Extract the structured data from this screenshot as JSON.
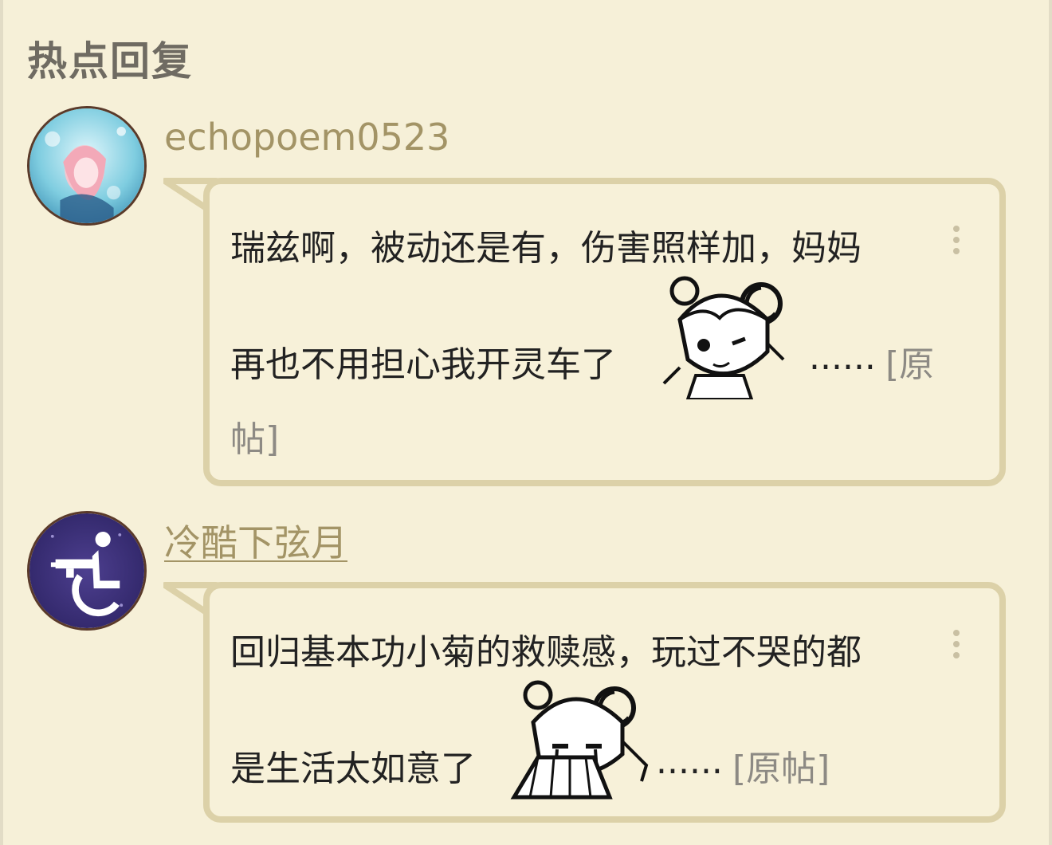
{
  "section": {
    "title": "热点回复"
  },
  "replies": [
    {
      "username": "echopoem0523",
      "text_line1": "瑞兹啊，被动还是有，伤害照样加，妈妈",
      "text_line2": "再也不用担心我开灵车了",
      "ellipsis": "......",
      "original_link_part1": "[原",
      "original_link_part2": "帖]",
      "sticker": "chibi-wink-sticker"
    },
    {
      "username": "冷酷下弦月",
      "text_line1": "回归基本功小菊的救赎感，玩过不哭的都",
      "text_line2": "是生活太如意了",
      "ellipsis": "......",
      "original_link": "[原帖]",
      "sticker": "chibi-crying-fan-sticker"
    }
  ],
  "colors": {
    "background": "#f6f0d8",
    "bubble_border": "#dcd1a8",
    "username": "#a39466",
    "section_title": "#6f6b62",
    "link_gray": "#8d8a84"
  }
}
